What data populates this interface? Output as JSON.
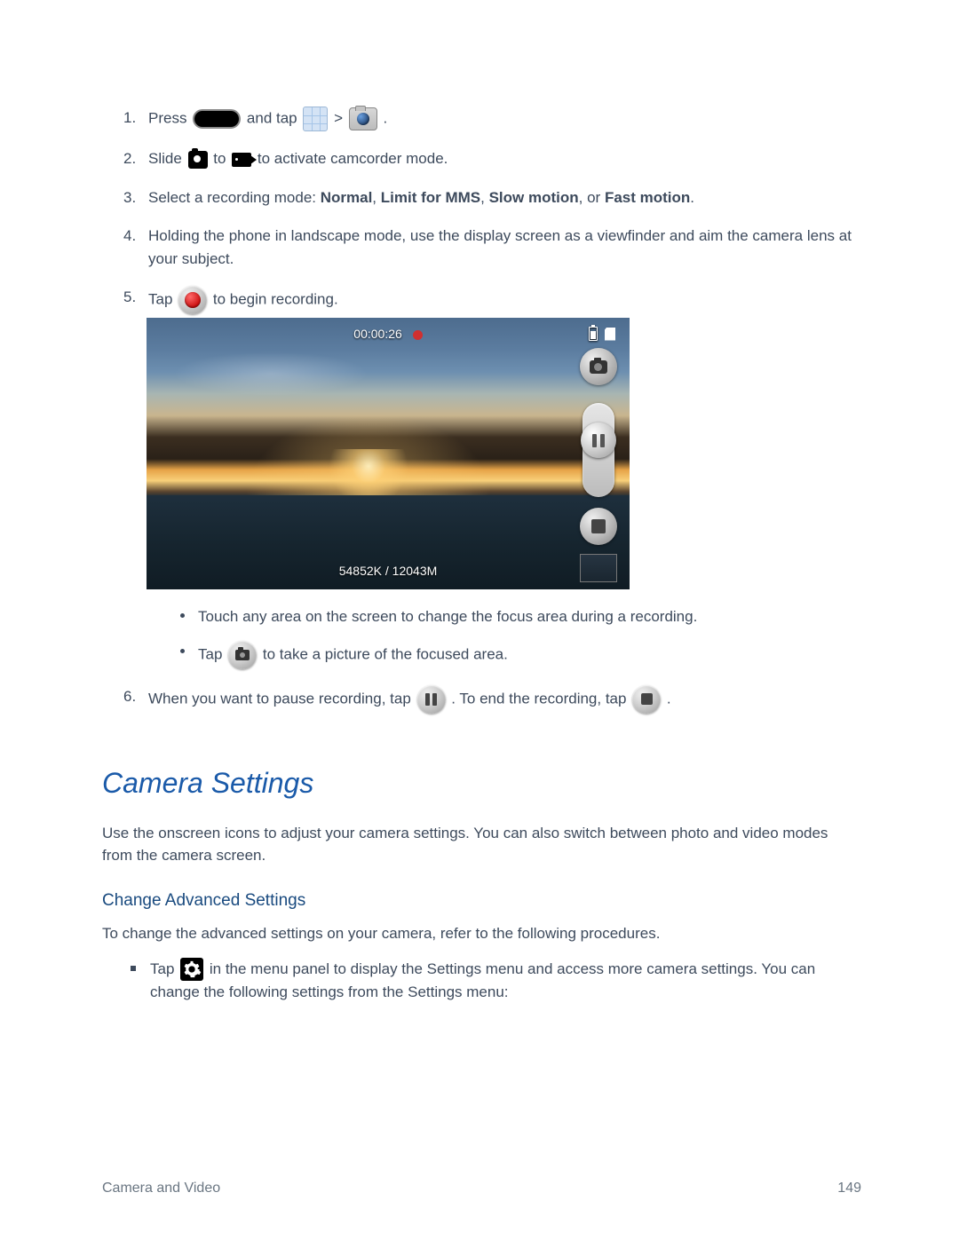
{
  "steps": {
    "s1": {
      "num": "1.",
      "t1": "Press ",
      "t2": " and tap ",
      "t3": " > ",
      "t4": "."
    },
    "s2": {
      "num": "2.",
      "t1": "Slide ",
      "t2": " to ",
      "t3": " to activate camcorder mode."
    },
    "s3": {
      "num": "3.",
      "lead": "Select a recording mode: ",
      "m1": "Normal",
      "c1": ", ",
      "m2": "Limit for MMS",
      "c2": ", ",
      "m3": "Slow motion",
      "c3": ", or ",
      "m4": "Fast motion",
      "tail": "."
    },
    "s4": {
      "num": "4.",
      "text": "Holding the phone in landscape mode, use the display screen as a viewfinder and aim the camera lens at your subject."
    },
    "s5": {
      "num": "5.",
      "t1": "Tap ",
      "t2": " to begin recording."
    },
    "s5_b1": "Touch any area on the screen to change the focus area during a recording.",
    "s5_b2": {
      "t1": "Tap ",
      "t2": " to take a picture of the focused area."
    },
    "s6": {
      "num": "6.",
      "t1": "When you want to pause recording, tap ",
      "t2": ". To end the recording, tap ",
      "t3": "."
    }
  },
  "camview": {
    "rec_time": "00:00:26",
    "storage": "54852K / 12043M"
  },
  "section_title": "Camera Settings",
  "section_para": "Use the onscreen icons to adjust your camera settings. You can also switch between photo and video modes from the camera screen.",
  "subhead": "Change Advanced Settings",
  "subpara": "To change the advanced settings on your camera, refer to the following procedures.",
  "gear_bullet": {
    "t1": "Tap ",
    "t2": " in the menu panel to display the Settings menu and access more camera settings. You can change the following settings from the Settings menu:"
  },
  "footer": {
    "left": "Camera and Video",
    "right": "149"
  }
}
